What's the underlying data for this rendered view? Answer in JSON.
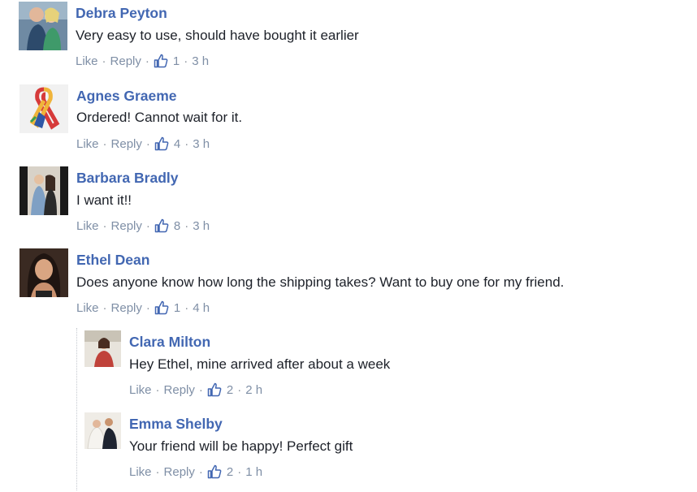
{
  "comments": [
    {
      "name": "Debra Peyton",
      "text": "Very easy to use, should have bought it earlier",
      "like": "Like",
      "reply": "Reply",
      "count": "1",
      "time": "3 h"
    },
    {
      "name": "Agnes Graeme",
      "text": "Ordered! Cannot wait for it.",
      "like": "Like",
      "reply": "Reply",
      "count": "4",
      "time": "3 h"
    },
    {
      "name": "Barbara Bradly",
      "text": "I want it!!",
      "like": "Like",
      "reply": "Reply",
      "count": "8",
      "time": "3 h"
    },
    {
      "name": "Ethel Dean",
      "text": "Does anyone know how long the shipping takes? Want to buy one for my friend.",
      "like": "Like",
      "reply": "Reply",
      "count": "1",
      "time": "4 h"
    },
    {
      "name": "Clara Milton",
      "text": "Hey Ethel, mine arrived after about a week",
      "like": "Like",
      "reply": "Reply",
      "count": "2",
      "time": "2 h"
    },
    {
      "name": "Emma Shelby",
      "text": "Your friend will be happy! Perfect gift",
      "like": "Like",
      "reply": "Reply",
      "count": "2",
      "time": "1 h"
    }
  ],
  "colors": {
    "name": "#4267b2",
    "text": "#1d2129",
    "meta": "#7f8fa6",
    "thumb": "#4267b2"
  },
  "icons": {
    "like": "thumbs-up-icon",
    "separator": "·"
  }
}
